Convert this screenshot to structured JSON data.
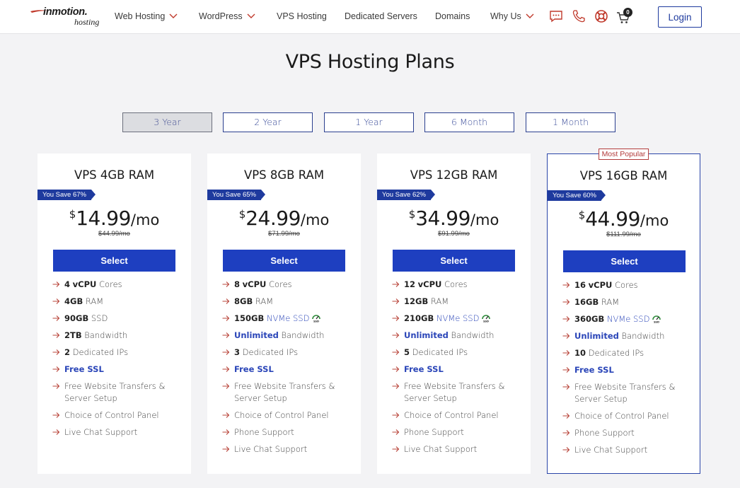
{
  "header": {
    "logo_brand": "inmotion.",
    "logo_sub": "hosting",
    "nav": [
      "Web Hosting",
      "WordPress",
      "VPS Hosting",
      "Dedicated Servers",
      "Domains",
      "Why Us"
    ],
    "cart_count": "0",
    "login_label": "Login"
  },
  "page_title": "VPS Hosting Plans",
  "terms": [
    "3 Year",
    "2 Year",
    "1 Year",
    "6 Month",
    "1 Month"
  ],
  "active_term": "3 Year",
  "popular_label": "Most Popular",
  "plans": [
    {
      "name": "VPS 4GB RAM",
      "save": "You Save 67%",
      "currency": "$",
      "price": "14.99",
      "per": "/mo",
      "old": "$44.99/mo",
      "select": "Select",
      "f": {
        "cpu_b": "4",
        "cpu_b2": "vCPU",
        "cpu_t": "Cores",
        "ram_b": "4GB",
        "ram_t": "RAM",
        "ssd_b": "90GB",
        "ssd_t": "SSD",
        "bw_b": "2TB",
        "bw_t": "Bandwidth",
        "ip_b": "2",
        "ip_t": "Dedicated IPs",
        "ssl": "Free SSL",
        "transfer": "Free Website Transfers & Server Setup",
        "panel": "Choice of Control Panel",
        "support": "Live Chat Support"
      }
    },
    {
      "name": "VPS 8GB RAM",
      "save": "You Save 65%",
      "currency": "$",
      "price": "24.99",
      "per": "/mo",
      "old": "$71.99/mo",
      "select": "Select",
      "f": {
        "cpu_b": "8",
        "cpu_b2": "vCPU",
        "cpu_t": "Cores",
        "ram_b": "8GB",
        "ram_t": "RAM",
        "ssd_b": "150GB",
        "ssd_t": "NVMe SSD",
        "bw_b": "Unlimited",
        "bw_t": "Bandwidth",
        "ip_b": "3",
        "ip_t": "Dedicated IPs",
        "ssl": "Free SSL",
        "transfer": "Free Website Transfers & Server Setup",
        "panel": "Choice of Control Panel",
        "support": "Phone Support",
        "support2": "Live Chat Support"
      }
    },
    {
      "name": "VPS 12GB RAM",
      "save": "You Save 62%",
      "currency": "$",
      "price": "34.99",
      "per": "/mo",
      "old": "$91.99/mo",
      "select": "Select",
      "f": {
        "cpu_b": "12",
        "cpu_b2": "vCPU",
        "cpu_t": "Cores",
        "ram_b": "12GB",
        "ram_t": "RAM",
        "ssd_b": "210GB",
        "ssd_t": "NVMe SSD",
        "bw_b": "Unlimited",
        "bw_t": "Bandwidth",
        "ip_b": "5",
        "ip_t": "Dedicated IPs",
        "ssl": "Free SSL",
        "transfer": "Free Website Transfers & Server Setup",
        "panel": "Choice of Control Panel",
        "support": "Phone Support",
        "support2": "Live Chat Support"
      }
    },
    {
      "name": "VPS 16GB RAM",
      "save": "You Save 60%",
      "currency": "$",
      "price": "44.99",
      "per": "/mo",
      "old": "$111.99/mo",
      "select": "Select",
      "f": {
        "cpu_b": "16",
        "cpu_b2": "vCPU",
        "cpu_t": "Cores",
        "ram_b": "16GB",
        "ram_t": "RAM",
        "ssd_b": "360GB",
        "ssd_t": "NVMe SSD",
        "bw_b": "Unlimited",
        "bw_t": "Bandwidth",
        "ip_b": "10",
        "ip_t": "Dedicated IPs",
        "ssl": "Free SSL",
        "transfer": "Free Website Transfers & Server Setup",
        "panel": "Choice of Control Panel",
        "support": "Phone Support",
        "support2": "Live Chat Support"
      }
    }
  ],
  "colors": {
    "accent": "#1e3fc0",
    "brand_red": "#c0392b",
    "popular_border": "#2a45a8"
  },
  "icons": [
    "chat-icon",
    "phone-icon",
    "lifebuoy-icon",
    "cart-icon",
    "chevron-down-icon",
    "arrow-right-icon",
    "nvme-icon"
  ]
}
